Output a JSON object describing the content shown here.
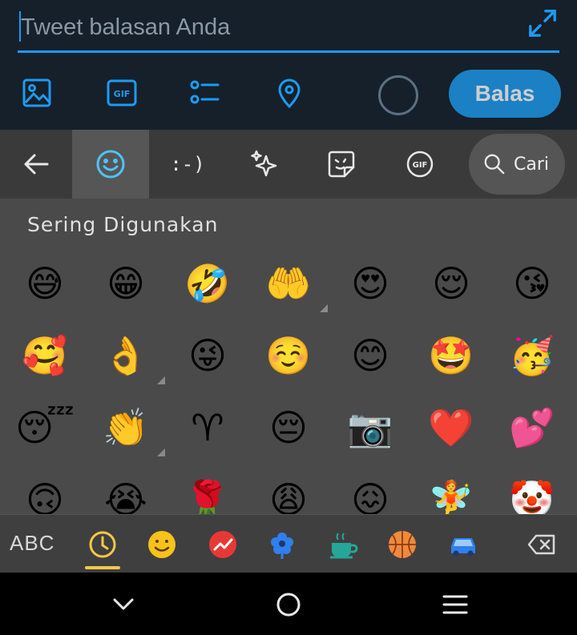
{
  "compose": {
    "placeholder": "Tweet balasan Anda",
    "reply_button": "Balas",
    "accent": "#1d9bf0",
    "toolbar_icons": [
      "image-icon",
      "gif-icon",
      "poll-icon",
      "location-icon"
    ]
  },
  "keyboard": {
    "tabs": [
      "back-arrow-icon",
      "emoji-icon",
      "emoticon-icon",
      "sparkle-icon",
      "sticker-icon",
      "gif-icon"
    ],
    "active_tab": "emoji-icon",
    "search_label": "Cari",
    "section_title": "Sering Digunakan",
    "emojis": [
      [
        "😅",
        "😁",
        "🤣",
        "🤲",
        "😍",
        "😌",
        "😘"
      ],
      [
        "🥰",
        "👌",
        "😜",
        "☺️",
        "😊",
        "🤩",
        "🥳"
      ],
      [
        "😴",
        "👏",
        "♈",
        "😔",
        "📷",
        "❤️",
        "💕"
      ],
      [
        "🙃",
        "😭",
        "🌹",
        "😩",
        "😖",
        "🧚",
        "🤡"
      ]
    ],
    "abc_label": "ABC",
    "categories": [
      "recent-icon",
      "smiley-icon",
      "trending-icon",
      "flower-icon",
      "coffee-icon",
      "basketball-icon",
      "car-icon"
    ],
    "active_category": "recent-icon"
  },
  "navbar": {
    "icons": [
      "back-chevron-icon",
      "home-circle-icon",
      "recents-menu-icon"
    ]
  }
}
